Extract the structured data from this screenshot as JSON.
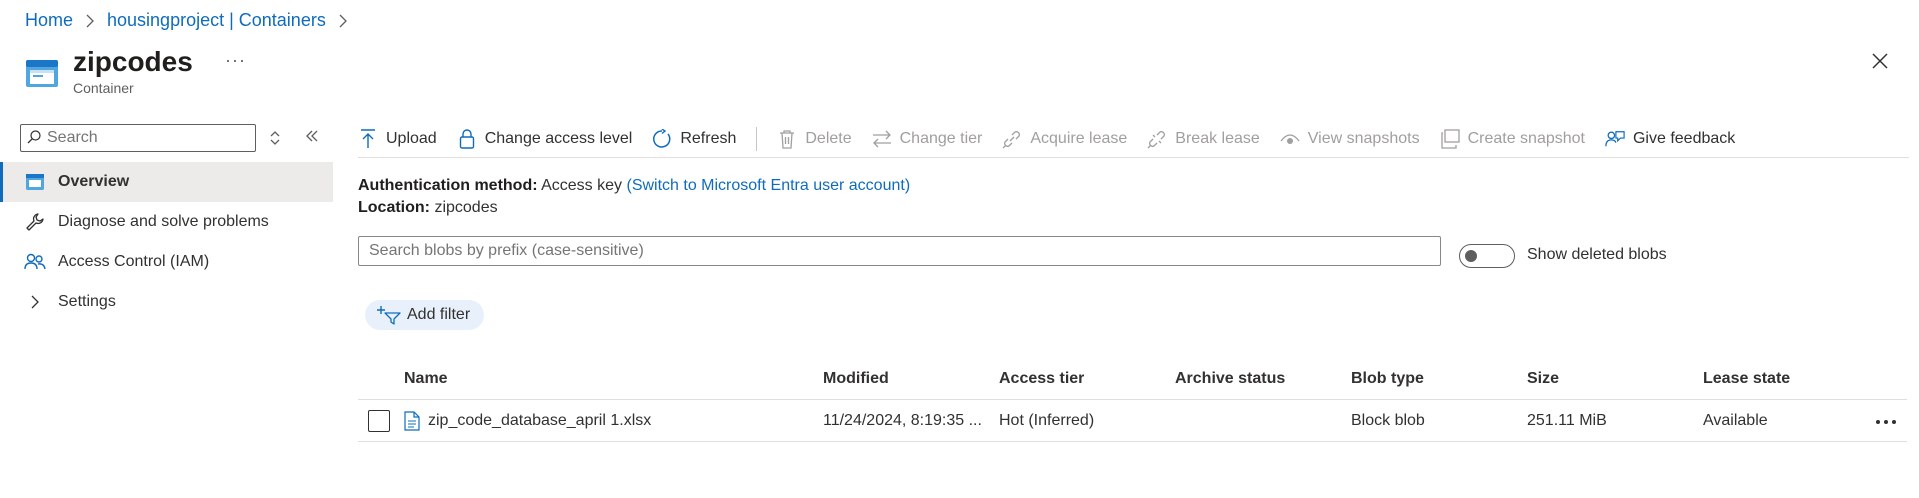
{
  "breadcrumb": {
    "items": [
      "Home",
      "housingproject | Containers"
    ]
  },
  "header": {
    "title": "zipcodes",
    "subtitle": "Container",
    "more": "···"
  },
  "sidebar": {
    "search_placeholder": "Search",
    "items": [
      {
        "label": "Overview",
        "icon": "container-icon",
        "active": true
      },
      {
        "label": "Diagnose and solve problems",
        "icon": "wrench-icon"
      },
      {
        "label": "Access Control (IAM)",
        "icon": "people-icon"
      },
      {
        "label": "Settings",
        "icon": "chevron-right-icon"
      }
    ]
  },
  "toolbar": {
    "upload": "Upload",
    "change_access": "Change access level",
    "refresh": "Refresh",
    "delete": "Delete",
    "change_tier": "Change tier",
    "acquire_lease": "Acquire lease",
    "break_lease": "Break lease",
    "view_snapshots": "View snapshots",
    "create_snapshot": "Create snapshot",
    "give_feedback": "Give feedback"
  },
  "info": {
    "auth_label": "Authentication method:",
    "auth_value": "Access key",
    "auth_link": "(Switch to Microsoft Entra user account)",
    "location_label": "Location:",
    "location_value": "zipcodes"
  },
  "blob_search": {
    "placeholder": "Search blobs by prefix (case-sensitive)"
  },
  "show_deleted": {
    "label": "Show deleted blobs",
    "on": false
  },
  "add_filter": "Add filter",
  "table": {
    "headers": [
      "Name",
      "Modified",
      "Access tier",
      "Archive status",
      "Blob type",
      "Size",
      "Lease state"
    ],
    "rows": [
      {
        "name": "zip_code_database_april 1.xlsx",
        "modified": "11/24/2024, 8:19:35 ...",
        "access_tier": "Hot (Inferred)",
        "archive_status": "",
        "blob_type": "Block blob",
        "size": "251.11 MiB",
        "lease_state": "Available"
      }
    ]
  },
  "colors": {
    "accent": "#0f6cbd",
    "disabled": "#a19f9d",
    "nav_active_bg": "#edebe9",
    "filter_bg": "#e8f1fb"
  }
}
